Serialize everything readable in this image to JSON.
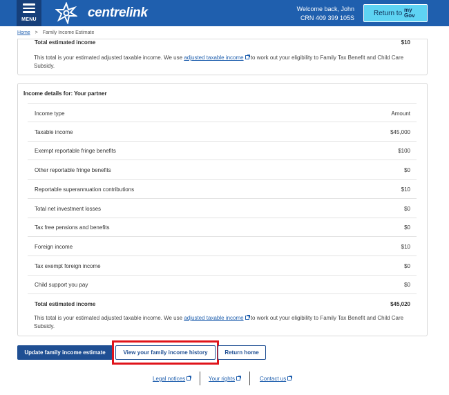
{
  "header": {
    "menu_label": "MENU",
    "brand": "centrelink",
    "welcome": "Welcome back, John",
    "crn": "CRN 409 399 105S",
    "return_label": "Return to",
    "mygov_line1": "my",
    "mygov_line2": "Gov",
    "brand_color": "#1f5fae"
  },
  "breadcrumb": {
    "home": "Home",
    "separator": ">",
    "current": "Family Income Estimate"
  },
  "top_card": {
    "total_label": "Total estimated income",
    "total_value": "$10",
    "note_before": "This total is your estimated adjusted taxable income. We use",
    "note_link": "adjusted taxable income",
    "note_after": "to work out your eligibility to Family Tax Benefit and Child Care Subsidy."
  },
  "partner_card": {
    "title": "Income details for: Your partner",
    "col_type": "Income type",
    "col_amount": "Amount",
    "rows": [
      {
        "name": "Taxable income",
        "amount": "$45,000"
      },
      {
        "name": "Exempt reportable fringe benefits",
        "amount": "$100"
      },
      {
        "name": "Other reportable fringe benefits",
        "amount": "$0"
      },
      {
        "name": "Reportable superannuation contributions",
        "amount": "$10"
      },
      {
        "name": "Total net investment losses",
        "amount": "$0"
      },
      {
        "name": "Tax free pensions and benefits",
        "amount": "$0"
      },
      {
        "name": "Foreign income",
        "amount": "$10"
      },
      {
        "name": "Tax exempt foreign income",
        "amount": "$0"
      },
      {
        "name": "Child support you pay",
        "amount": "$0"
      }
    ],
    "total_label": "Total estimated income",
    "total_value": "$45,020",
    "note_before": "This total is your estimated adjusted taxable income. We use",
    "note_link": "adjusted taxable income",
    "note_after": "to work out your eligibility to Family Tax Benefit and Child Care Subsidy."
  },
  "actions": {
    "update": "Update family income estimate",
    "history": "View your family income history",
    "return_home": "Return home"
  },
  "footer": {
    "legal": "Legal notices",
    "rights": "Your rights",
    "contact": "Contact us"
  },
  "icons": [
    "menu-icon",
    "centrelink-star-logo",
    "external-link-icon"
  ]
}
